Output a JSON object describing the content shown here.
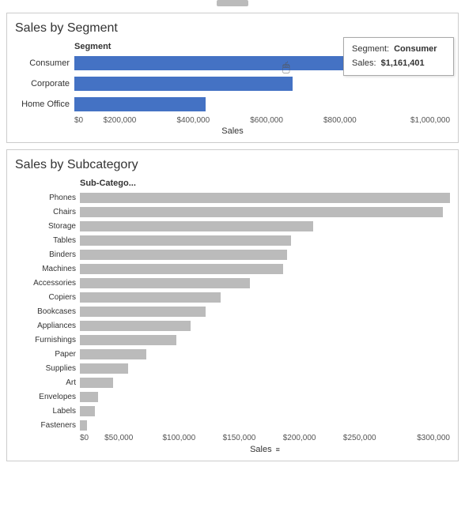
{
  "segment_chart": {
    "title": "Sales by Segment",
    "axis_label": "Segment",
    "x_label": "Sales",
    "bars": [
      {
        "label": "Consumer",
        "value": 1161401,
        "max": 1200000,
        "pct": 96,
        "color": "blue"
      },
      {
        "label": "Corporate",
        "value": 706146,
        "max": 1200000,
        "pct": 58,
        "color": "blue"
      },
      {
        "label": "Home Office",
        "value": 429653,
        "max": 1200000,
        "pct": 35,
        "color": "blue"
      }
    ],
    "x_ticks": [
      "$0",
      "$200,000",
      "$400,000",
      "$600,000",
      "$800,000",
      "$1,000,000"
    ],
    "tooltip": {
      "segment_label": "Segment:",
      "segment_value": "Consumer",
      "sales_label": "Sales:",
      "sales_value": "$1,161,401"
    }
  },
  "subcategory_chart": {
    "title": "Sales by Subcategory",
    "axis_label": "Sub-Catego...",
    "x_label": "Sales",
    "bars": [
      {
        "label": "Phones",
        "pct": 100
      },
      {
        "label": "Chairs",
        "pct": 98
      },
      {
        "label": "Storage",
        "pct": 63
      },
      {
        "label": "Tables",
        "pct": 57
      },
      {
        "label": "Binders",
        "pct": 56
      },
      {
        "label": "Machines",
        "pct": 55
      },
      {
        "label": "Accessories",
        "pct": 46
      },
      {
        "label": "Copiers",
        "pct": 38
      },
      {
        "label": "Bookcases",
        "pct": 34
      },
      {
        "label": "Appliances",
        "pct": 30
      },
      {
        "label": "Furnishings",
        "pct": 26
      },
      {
        "label": "Paper",
        "pct": 18
      },
      {
        "label": "Supplies",
        "pct": 13
      },
      {
        "label": "Art",
        "pct": 9
      },
      {
        "label": "Envelopes",
        "pct": 5
      },
      {
        "label": "Labels",
        "pct": 4
      },
      {
        "label": "Fasteners",
        "pct": 2
      }
    ],
    "x_ticks": [
      "$0",
      "$50,000",
      "$100,000",
      "$150,000",
      "$200,000",
      "$250,000",
      "$300,000"
    ]
  }
}
